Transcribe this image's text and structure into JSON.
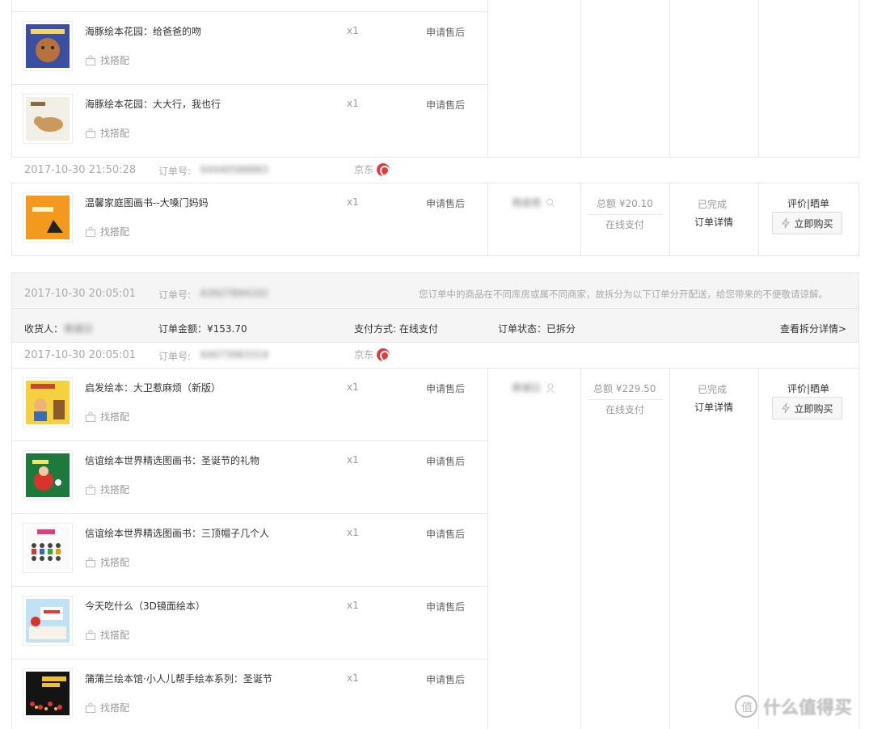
{
  "top_order": {
    "items": [
      {
        "name": "海豚绘本花园：给爸爸的吻",
        "qty": "x1",
        "service": "申请售后",
        "match": "找搭配"
      },
      {
        "name": "海豚绘本花园：大大行，我也行",
        "qty": "x1",
        "service": "申请售后",
        "match": "找搭配"
      }
    ]
  },
  "order_a": {
    "time": "2017-10-30 21:50:28",
    "order_no_label": "订单号:",
    "order_no": "64440588883",
    "shop": "京东",
    "item": {
      "name": "温馨家庭图画书--大嗓门妈妈",
      "qty": "x1",
      "service": "申请售后",
      "match": "找搭配"
    },
    "consignee": "用途用",
    "total": "总额 ¥20.10",
    "pay": "在线支付",
    "status": "已完成",
    "detail": "订单详情",
    "review": "评价|晒单",
    "buy": "立即购买"
  },
  "split_order": {
    "time": "2017-10-30 20:05:01",
    "order_no_label": "订单号:",
    "order_no": "63927894102",
    "notice": "您订单中的商品在不同库房或属不同商家，故拆分为以下订单分开配送，给您带来的不便敬请谅解。",
    "consignee_label": "收货人：",
    "consignee": "蒋城日",
    "amount": "订单金额：¥153.70",
    "payment": "支付方式: 在线支付",
    "state": "订单状态：已拆分",
    "split_detail": "查看拆分详情>"
  },
  "order_b": {
    "time": "2017-10-30 20:05:01",
    "order_no_label": "订单号:",
    "order_no": "64073983319",
    "shop": "京东",
    "items": [
      {
        "name": "启发绘本：大卫惹麻烦（新版）",
        "qty": "x1",
        "service": "申请售后",
        "match": "找搭配"
      },
      {
        "name": "信谊绘本世界精选图画书：圣诞节的礼物",
        "qty": "x1",
        "service": "申请售后",
        "match": "找搭配"
      },
      {
        "name": "信谊绘本世界精选图画书：三顶帽子几个人",
        "qty": "x1",
        "service": "申请售后",
        "match": "找搭配"
      },
      {
        "name": "今天吃什么（3D镜面绘本）",
        "qty": "x1",
        "service": "申请售后",
        "match": "找搭配"
      },
      {
        "name": "蒲蒲兰绘本馆·小人儿帮手绘本系列：圣诞节",
        "qty": "x1",
        "service": "申请售后",
        "match": "找搭配"
      }
    ],
    "consignee": "蒋城日",
    "total": "总额 ¥229.50",
    "pay": "在线支付",
    "status": "已完成",
    "detail": "订单详情",
    "review": "评价|晒单",
    "buy": "立即购买"
  },
  "watermark": "什么值得买",
  "colors": {
    "jd_red": "#e4393c",
    "border": "#e6e6e6",
    "bar_bg": "#f5f5f5"
  }
}
